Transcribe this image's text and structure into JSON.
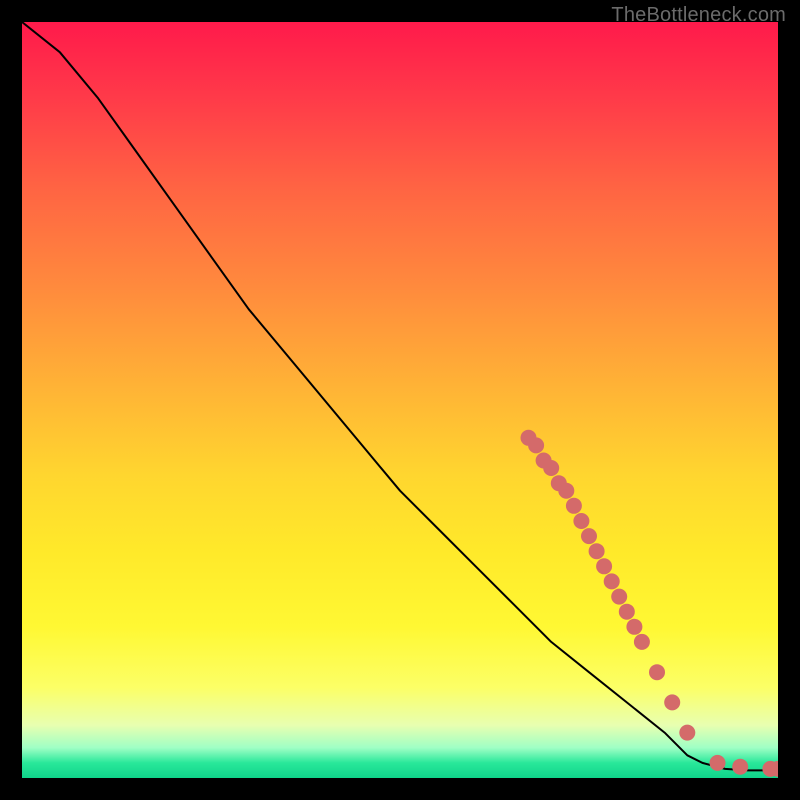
{
  "watermark": "TheBottleneck.com",
  "chart_data": {
    "type": "line",
    "title": "",
    "xlabel": "",
    "ylabel": "",
    "xlim": [
      0,
      100
    ],
    "ylim": [
      0,
      100
    ],
    "grid": false,
    "series": [
      {
        "name": "curve",
        "type": "line",
        "color": "#000000",
        "x": [
          0,
          5,
          10,
          15,
          20,
          25,
          30,
          35,
          40,
          45,
          50,
          55,
          60,
          65,
          67,
          70,
          75,
          80,
          85,
          88,
          90,
          93,
          96,
          100
        ],
        "y": [
          100,
          96,
          90,
          83,
          76,
          69,
          62,
          56,
          50,
          44,
          38,
          33,
          28,
          23,
          21,
          18,
          14,
          10,
          6,
          3,
          2,
          1.2,
          1,
          1
        ]
      },
      {
        "name": "dots",
        "type": "scatter",
        "color": "#d46a6a",
        "x": [
          67,
          68,
          69,
          70,
          71,
          72,
          73,
          74,
          75,
          76,
          77,
          78,
          79,
          80,
          81,
          82,
          84,
          86,
          88,
          92,
          95,
          99,
          100
        ],
        "y": [
          45,
          44,
          42,
          41,
          39,
          38,
          36,
          34,
          32,
          30,
          28,
          26,
          24,
          22,
          20,
          18,
          14,
          10,
          6,
          2,
          1.5,
          1.2,
          1.2
        ]
      }
    ],
    "background_gradient": {
      "direction": "vertical",
      "stops": [
        {
          "pos": 0.0,
          "color": "#ff1a4b"
        },
        {
          "pos": 0.1,
          "color": "#ff3a49"
        },
        {
          "pos": 0.22,
          "color": "#ff6443"
        },
        {
          "pos": 0.35,
          "color": "#ff8a3d"
        },
        {
          "pos": 0.48,
          "color": "#ffb236"
        },
        {
          "pos": 0.6,
          "color": "#ffd62f"
        },
        {
          "pos": 0.7,
          "color": "#ffe92a"
        },
        {
          "pos": 0.8,
          "color": "#fff833"
        },
        {
          "pos": 0.88,
          "color": "#fcff66"
        },
        {
          "pos": 0.93,
          "color": "#e8ffb0"
        },
        {
          "pos": 0.96,
          "color": "#9fffc5"
        },
        {
          "pos": 0.98,
          "color": "#29e89a"
        },
        {
          "pos": 1.0,
          "color": "#0fd48a"
        }
      ]
    }
  }
}
